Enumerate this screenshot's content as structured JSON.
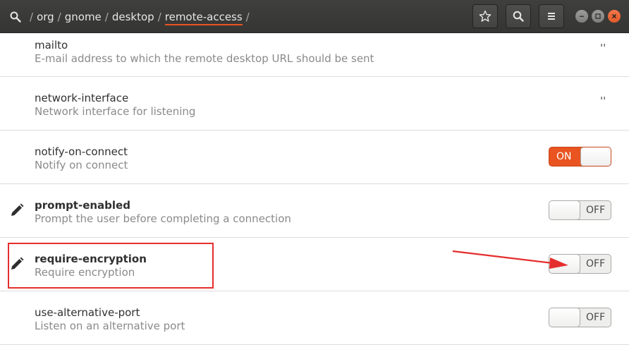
{
  "header": {
    "path": [
      "org",
      "gnome",
      "desktop",
      "remote-access"
    ],
    "separator": "/"
  },
  "toolbar": {
    "buttons": [
      "star-icon",
      "search-icon",
      "menu-icon"
    ]
  },
  "window_controls": [
    "minimize",
    "maximize",
    "close"
  ],
  "keys": [
    {
      "name": "mailto",
      "description": "E-mail address to which the remote desktop URL should be sent",
      "value": "''",
      "modified": false
    },
    {
      "name": "network-interface",
      "description": "Network interface for listening",
      "value": "''",
      "modified": false
    },
    {
      "name": "notify-on-connect",
      "description": "Notify on connect",
      "toggle": "ON",
      "modified": false
    },
    {
      "name": "prompt-enabled",
      "description": "Prompt the user before completing a connection",
      "toggle": "OFF",
      "modified": true
    },
    {
      "name": "require-encryption",
      "description": "Require encryption",
      "toggle": "OFF",
      "modified": true
    },
    {
      "name": "use-alternative-port",
      "description": "Listen on an alternative port",
      "toggle": "OFF",
      "modified": false
    }
  ],
  "colors": {
    "accent": "#e95420",
    "annotation": "#e52e2e",
    "header_bg": "#3a3a38"
  }
}
